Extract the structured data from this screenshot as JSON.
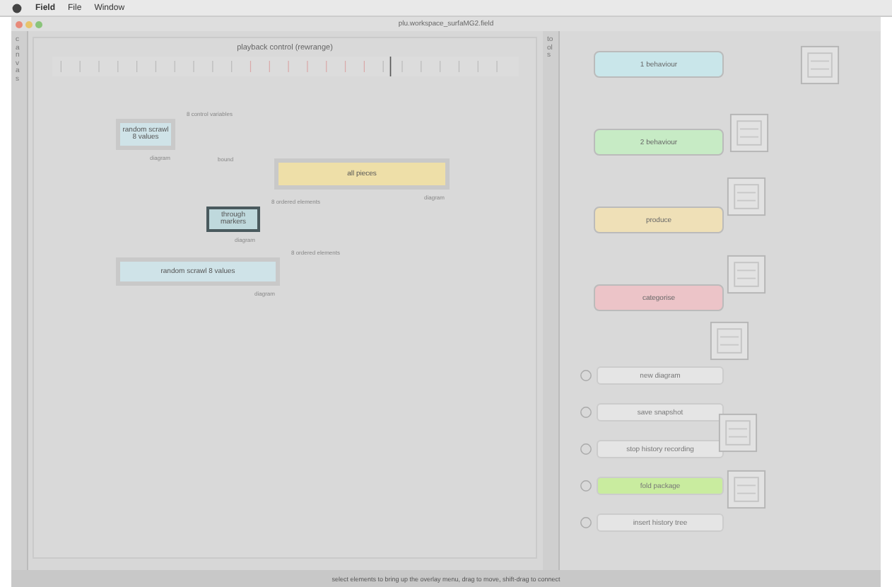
{
  "menu_bar": {
    "items": [
      "Field",
      "File",
      "Window"
    ]
  },
  "window": {
    "title": "plu.workspace_surfaMG2.field"
  },
  "left_tab": {
    "label": "canvas"
  },
  "right_tab": {
    "label": "tools"
  },
  "canvas": {
    "title": "playback control (rewrange)",
    "nodes": [
      {
        "label": "random scrawl 8 values",
        "caption": "diagram",
        "note": "8 control variables",
        "selected": false,
        "color": "#cfe3e8"
      },
      {
        "label": "all pieces",
        "caption": "diagram",
        "note": "bound",
        "selected": false,
        "color": "#eedfa8"
      },
      {
        "label": "through markers",
        "caption": "diagram",
        "note": "8 ordered elements",
        "selected": true,
        "color": "#bfd9dd"
      },
      {
        "label": "random scrawl 8 values",
        "caption": "diagram",
        "note": "8 ordered elements",
        "selected": false,
        "color": "#cfe3e8"
      }
    ]
  },
  "palette": [
    {
      "label": "1 behaviour",
      "color": "#c9e6ea"
    },
    {
      "label": "2 behaviour",
      "color": "#c7ebc5"
    },
    {
      "label": "produce",
      "color": "#efe0b7"
    },
    {
      "label": "categorise",
      "color": "#ecc4c8"
    }
  ],
  "actions": [
    {
      "label": "new diagram",
      "highlighted": false
    },
    {
      "label": "save snapshot",
      "highlighted": false
    },
    {
      "label": "stop history recording",
      "highlighted": false
    },
    {
      "label": "fold package",
      "highlighted": true
    },
    {
      "label": "insert history tree",
      "highlighted": false
    }
  ],
  "status_bar": {
    "text": "select elements to bring up the overlay menu, drag to move, shift-drag to connect"
  }
}
